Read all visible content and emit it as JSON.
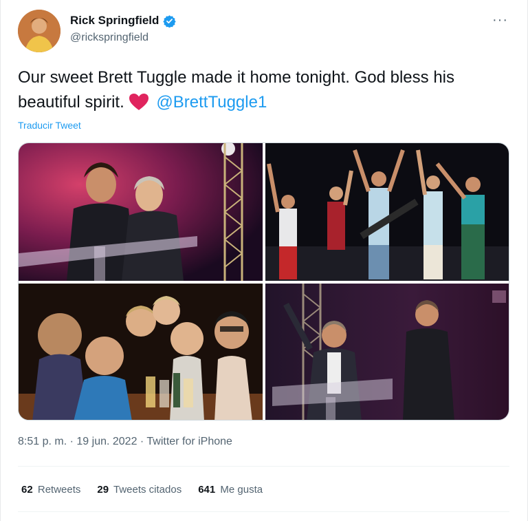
{
  "tweet": {
    "display_name": "Rick Springfield",
    "handle": "@rickspringfield",
    "text": "Our sweet Brett Tuggle made it home tonight. God bless his beautiful spirit.",
    "mention": "@BrettTuggle1",
    "translate_label": "Traducir Tweet",
    "time": "8:51 p. m.",
    "date": "19 jun. 2022",
    "source": "Twitter for iPhone",
    "separator": "·",
    "more_label": "···"
  },
  "stats": {
    "retweets_count": "62",
    "retweets_label": "Retweets",
    "quotes_count": "29",
    "quotes_label": "Tweets citados",
    "likes_count": "641",
    "likes_label": "Me gusta"
  },
  "colors": {
    "accent": "#1d9bf0",
    "text": "#0f1419",
    "secondary": "#536471",
    "heart": "#f91880"
  },
  "icons": {
    "verified": "verified-badge-icon",
    "heart": "red-heart-emoji",
    "more": "more-options-icon"
  }
}
